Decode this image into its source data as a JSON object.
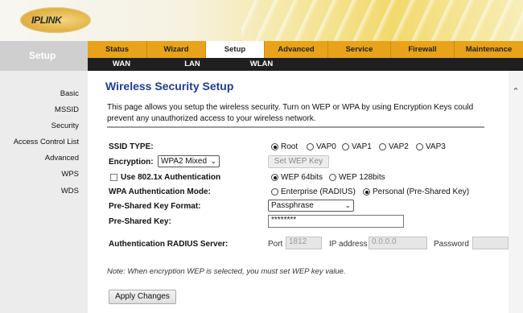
{
  "logo": {
    "main": "IPLINK"
  },
  "side": {
    "title": "Setup",
    "items": [
      "Basic",
      "MSSID",
      "Security",
      "Access Control List",
      "Advanced",
      "WPS",
      "WDS"
    ]
  },
  "nav": {
    "tabs": [
      "Status",
      "Wizard",
      "Setup",
      "Advanced",
      "Service",
      "Firewall",
      "Maintenance"
    ],
    "active_tab": "Setup",
    "subtabs": [
      "WAN",
      "LAN",
      "WLAN"
    ]
  },
  "page": {
    "title": "Wireless Security Setup",
    "description": "This page allows you setup the wireless security. Turn on WEP or WPA by using Encryption Keys could prevent any unauthorized access to your wireless network."
  },
  "form": {
    "ssid_type_label": "SSID TYPE:",
    "ssid_options": [
      "Root",
      "VAP0",
      "VAP1",
      "VAP2",
      "VAP3"
    ],
    "ssid_selected": "Root",
    "encryption_label": "Encryption:",
    "encryption_value": "WPA2 Mixed",
    "set_wep_key_label": "Set WEP Key",
    "use_8021x_label": "Use 802.1x Authentication",
    "wep_options": [
      "WEP 64bits",
      "WEP 128bits"
    ],
    "wep_selected": "WEP 64bits",
    "wpa_auth_label": "WPA Authentication Mode:",
    "wpa_auth_options": [
      "Enterprise (RADIUS)",
      "Personal (Pre-Shared Key)"
    ],
    "wpa_auth_selected": "Personal (Pre-Shared Key)",
    "psk_format_label": "Pre-Shared Key Format:",
    "psk_format_value": "Passphrase",
    "psk_label": "Pre-Shared Key:",
    "psk_value": "********",
    "radius_label": "Authentication RADIUS Server:",
    "port_label": "Port",
    "port_value": "1812",
    "ip_label": "IP address",
    "ip_value": "0.0.0.0",
    "password_label": "Password",
    "password_value": "",
    "note": "Note: When encryption WEP is selected, you must set WEP key value.",
    "apply_label": "Apply Changes"
  },
  "colors": {
    "nav_orange": "#e8a31b",
    "subnav_black": "#1f1f1f",
    "title_blue": "#1f3d8f",
    "sidebar_gray": "#ececec"
  }
}
